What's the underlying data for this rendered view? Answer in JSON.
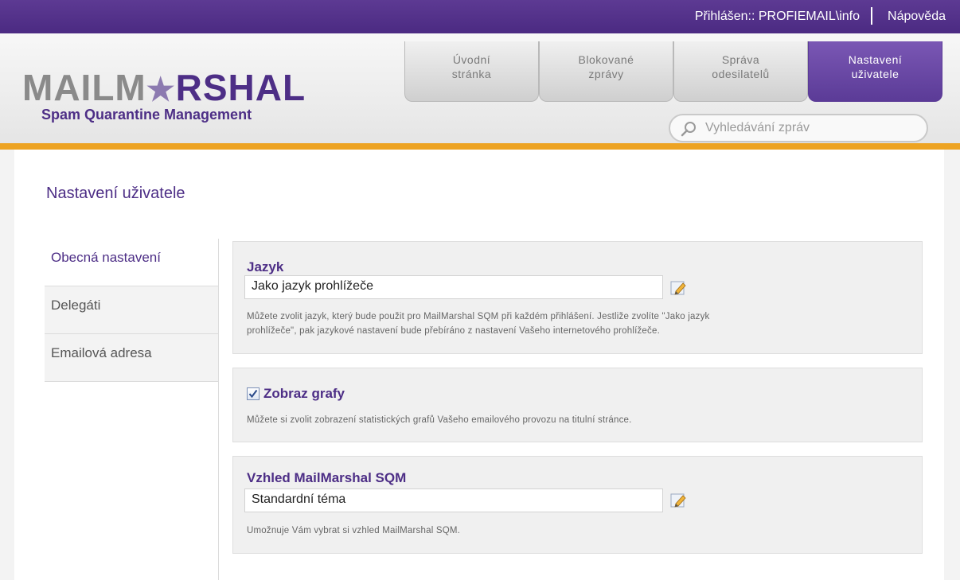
{
  "topbar": {
    "login": "Přihlášen:: PROFIEMAIL\\info",
    "help": "Nápověda"
  },
  "logo": {
    "part1": "MAILM",
    "star": "★",
    "part2": "RSHAL",
    "tagline": "Spam Quarantine Management"
  },
  "tabs": [
    {
      "line1": "Úvodní",
      "line2": "stránka"
    },
    {
      "line1": "Blokované",
      "line2": "zprávy"
    },
    {
      "line1": "Správa",
      "line2": "odesilatelů"
    },
    {
      "line1": "Nastavení",
      "line2": "uživatele"
    }
  ],
  "search": {
    "placeholder": "Vyhledávání zpráv"
  },
  "page": {
    "title": "Nastavení uživatele"
  },
  "sidenav": [
    {
      "label": "Obecná nastavení"
    },
    {
      "label": "Delegáti"
    },
    {
      "label": "Emailová adresa"
    }
  ],
  "sections": {
    "language": {
      "title": "Jazyk",
      "value": "Jako jazyk prohlížeče",
      "desc_line1": "Můžete zvolit jazyk, který bude použit pro MailMarshal SQM při každém přihlášení. Jestliže zvolíte \"Jako jazyk",
      "desc_line2": "prohlížeče\", pak jazykové nastavení bude přebíráno z nastavení Vašeho internetového prohlížeče."
    },
    "graphs": {
      "label": "Zobraz grafy",
      "checked": true,
      "desc": "Můžete si zvolit zobrazení statistických grafů Vašeho emailového provozu na titulní stránce."
    },
    "theme": {
      "title": "Vzhled MailMarshal SQM",
      "value": "Standardní téma",
      "desc": "Umožnuje Vám vybrat si vzhled MailMarshal SQM."
    }
  },
  "colors": {
    "brand_purple": "#4d2e86",
    "accent_orange": "#eda322"
  }
}
